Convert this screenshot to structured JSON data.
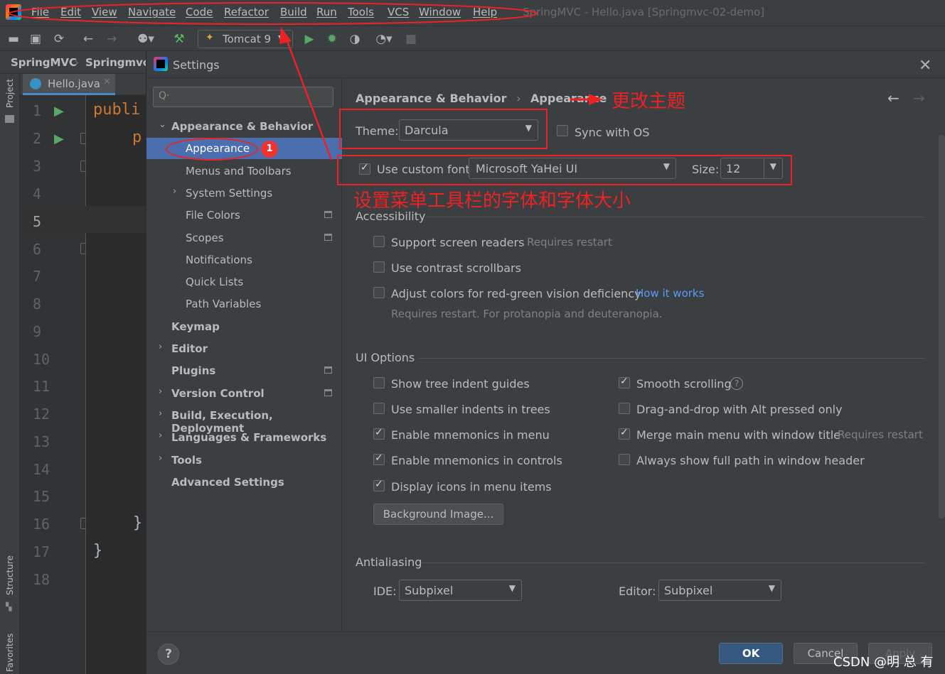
{
  "window": {
    "title": "SpringMVC - Hello.java [Springmvc-02-demo]"
  },
  "menu": [
    "File",
    "Edit",
    "View",
    "Navigate",
    "Code",
    "Refactor",
    "Build",
    "Run",
    "Tools",
    "VCS",
    "Window",
    "Help"
  ],
  "toolbar": {
    "run_config": "Tomcat 9"
  },
  "ide": {
    "breadcrumb": [
      "SpringMVC",
      "Springmvc-"
    ],
    "tab": "Hello.java",
    "tool_windows": {
      "project": "Project",
      "structure": "Structure",
      "favorites": "Favorites"
    },
    "line_numbers": [
      "1",
      "2",
      "3",
      "4",
      "5",
      "6",
      "7",
      "8",
      "9",
      "10",
      "11",
      "12",
      "13",
      "14",
      "15",
      "16",
      "17",
      "18"
    ],
    "code": {
      "line1": "publi",
      "line2": "p",
      "line16": "}",
      "line17": "}"
    }
  },
  "settings": {
    "title": "Settings",
    "search_placeholder": "Q·",
    "nav": [
      {
        "label": "Appearance & Behavior",
        "level": 0,
        "expanded": true,
        "bold": true
      },
      {
        "label": "Appearance",
        "level": 1,
        "selected": true
      },
      {
        "label": "Menus and Toolbars",
        "level": 1
      },
      {
        "label": "System Settings",
        "level": 1,
        "collapsed": true
      },
      {
        "label": "File Colors",
        "level": 1,
        "project_icon": true
      },
      {
        "label": "Scopes",
        "level": 1,
        "project_icon": true
      },
      {
        "label": "Notifications",
        "level": 1
      },
      {
        "label": "Quick Lists",
        "level": 1
      },
      {
        "label": "Path Variables",
        "level": 1
      },
      {
        "label": "Keymap",
        "level": 0,
        "bold": true
      },
      {
        "label": "Editor",
        "level": 0,
        "bold": true,
        "collapsed": true
      },
      {
        "label": "Plugins",
        "level": 0,
        "bold": true,
        "project_icon": true
      },
      {
        "label": "Version Control",
        "level": 0,
        "bold": true,
        "collapsed": true,
        "project_icon": true
      },
      {
        "label": "Build, Execution, Deployment",
        "level": 0,
        "bold": true,
        "collapsed": true
      },
      {
        "label": "Languages & Frameworks",
        "level": 0,
        "bold": true,
        "collapsed": true
      },
      {
        "label": "Tools",
        "level": 0,
        "bold": true,
        "collapsed": true
      },
      {
        "label": "Advanced Settings",
        "level": 0,
        "bold": true
      }
    ],
    "breadcrumb": [
      "Appearance & Behavior",
      "Appearance"
    ],
    "theme_label": "Theme:",
    "theme_value": "Darcula",
    "sync_os": "Sync with OS",
    "custom_font_label": "Use custom font:",
    "custom_font_value": "Microsoft YaHei UI",
    "size_label": "Size:",
    "size_value": "12",
    "accessibility": {
      "title": "Accessibility",
      "screen_readers": "Support screen readers",
      "screen_readers_note": "Requires restart",
      "contrast_scrollbars": "Use contrast scrollbars",
      "red_green": "Adjust colors for red-green vision deficiency",
      "how_it_works": "How it works",
      "red_green_note": "Requires restart. For protanopia and deuteranopia."
    },
    "ui_options": {
      "title": "UI Options",
      "tree_indent": "Show tree indent guides",
      "smaller_indents": "Use smaller indents in trees",
      "mnemonics_menu": "Enable mnemonics in menu",
      "mnemonics_controls": "Enable mnemonics in controls",
      "display_icons": "Display icons in menu items",
      "smooth_scrolling": "Smooth scrolling",
      "drag_drop": "Drag-and-drop with Alt pressed only",
      "merge_menu": "Merge main menu with window title",
      "merge_menu_note": "Requires restart",
      "full_path": "Always show full path in window header",
      "background_image": "Background Image..."
    },
    "antialiasing": {
      "title": "Antialiasing",
      "ide_label": "IDE:",
      "ide_value": "Subpixel",
      "editor_label": "Editor:",
      "editor_value": "Subpixel"
    },
    "footer": {
      "help": "?",
      "ok": "OK",
      "cancel": "Cancel",
      "apply": "Apply"
    }
  },
  "annotations": {
    "theme_note": "更改主题",
    "font_note": "设置菜单工具栏的字体和字体大小",
    "badge": "1"
  },
  "watermark": "CSDN @明 总 有"
}
